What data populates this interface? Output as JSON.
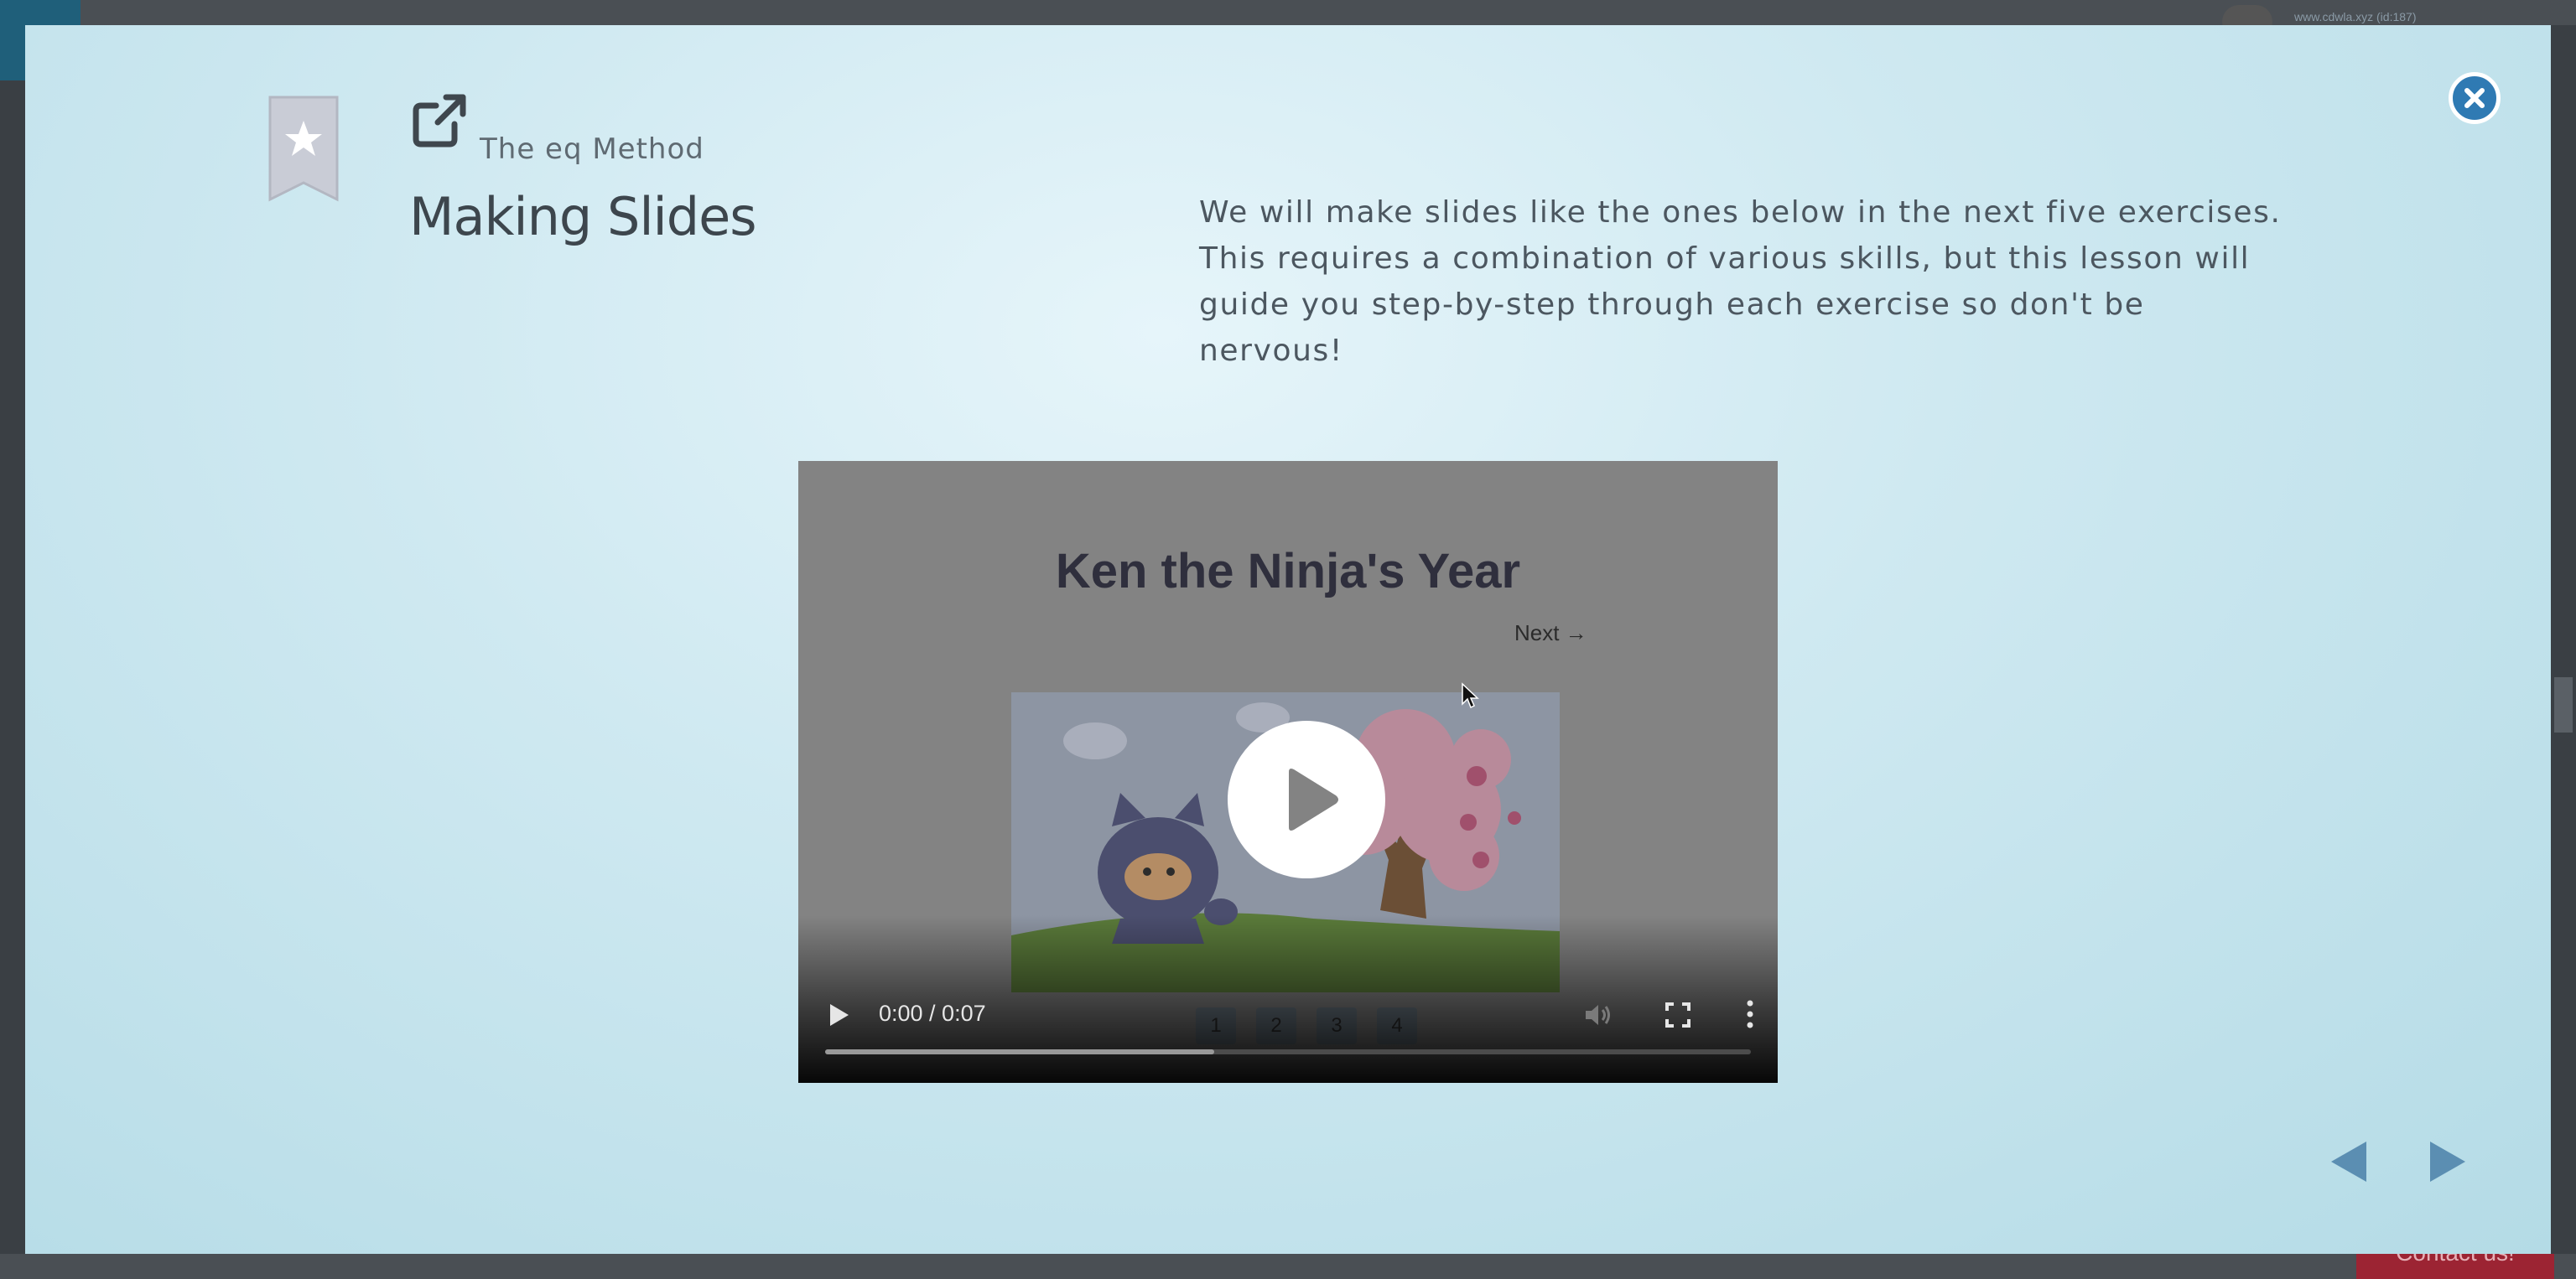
{
  "background": {
    "url_text": "www.cdwla.xyz (id:187)",
    "contact_label": "Contact us!"
  },
  "modal": {
    "course_label": "The eq Method",
    "lesson_title": "Making Slides",
    "description": "We will make slides like the ones below in the next five exercises. This requires a combination of various skills, but this lesson will guide you step-by-step through each exercise so don't be nervous!",
    "icons": [
      "star-bookmark-icon",
      "external-link-icon",
      "close-icon"
    ],
    "colors": {
      "accent": "#2f7ab3",
      "arrow": "#5b8eb2"
    }
  },
  "video": {
    "slide_title": "Ken the Ninja's Year",
    "next_label": "Next →",
    "slide_pages": [
      "1",
      "2",
      "3",
      "4"
    ],
    "time_display": "0:00 / 0:07",
    "progress": 0.42
  },
  "navigation": {
    "prev_icon": "triangle-left-icon",
    "next_icon": "triangle-right-icon"
  }
}
